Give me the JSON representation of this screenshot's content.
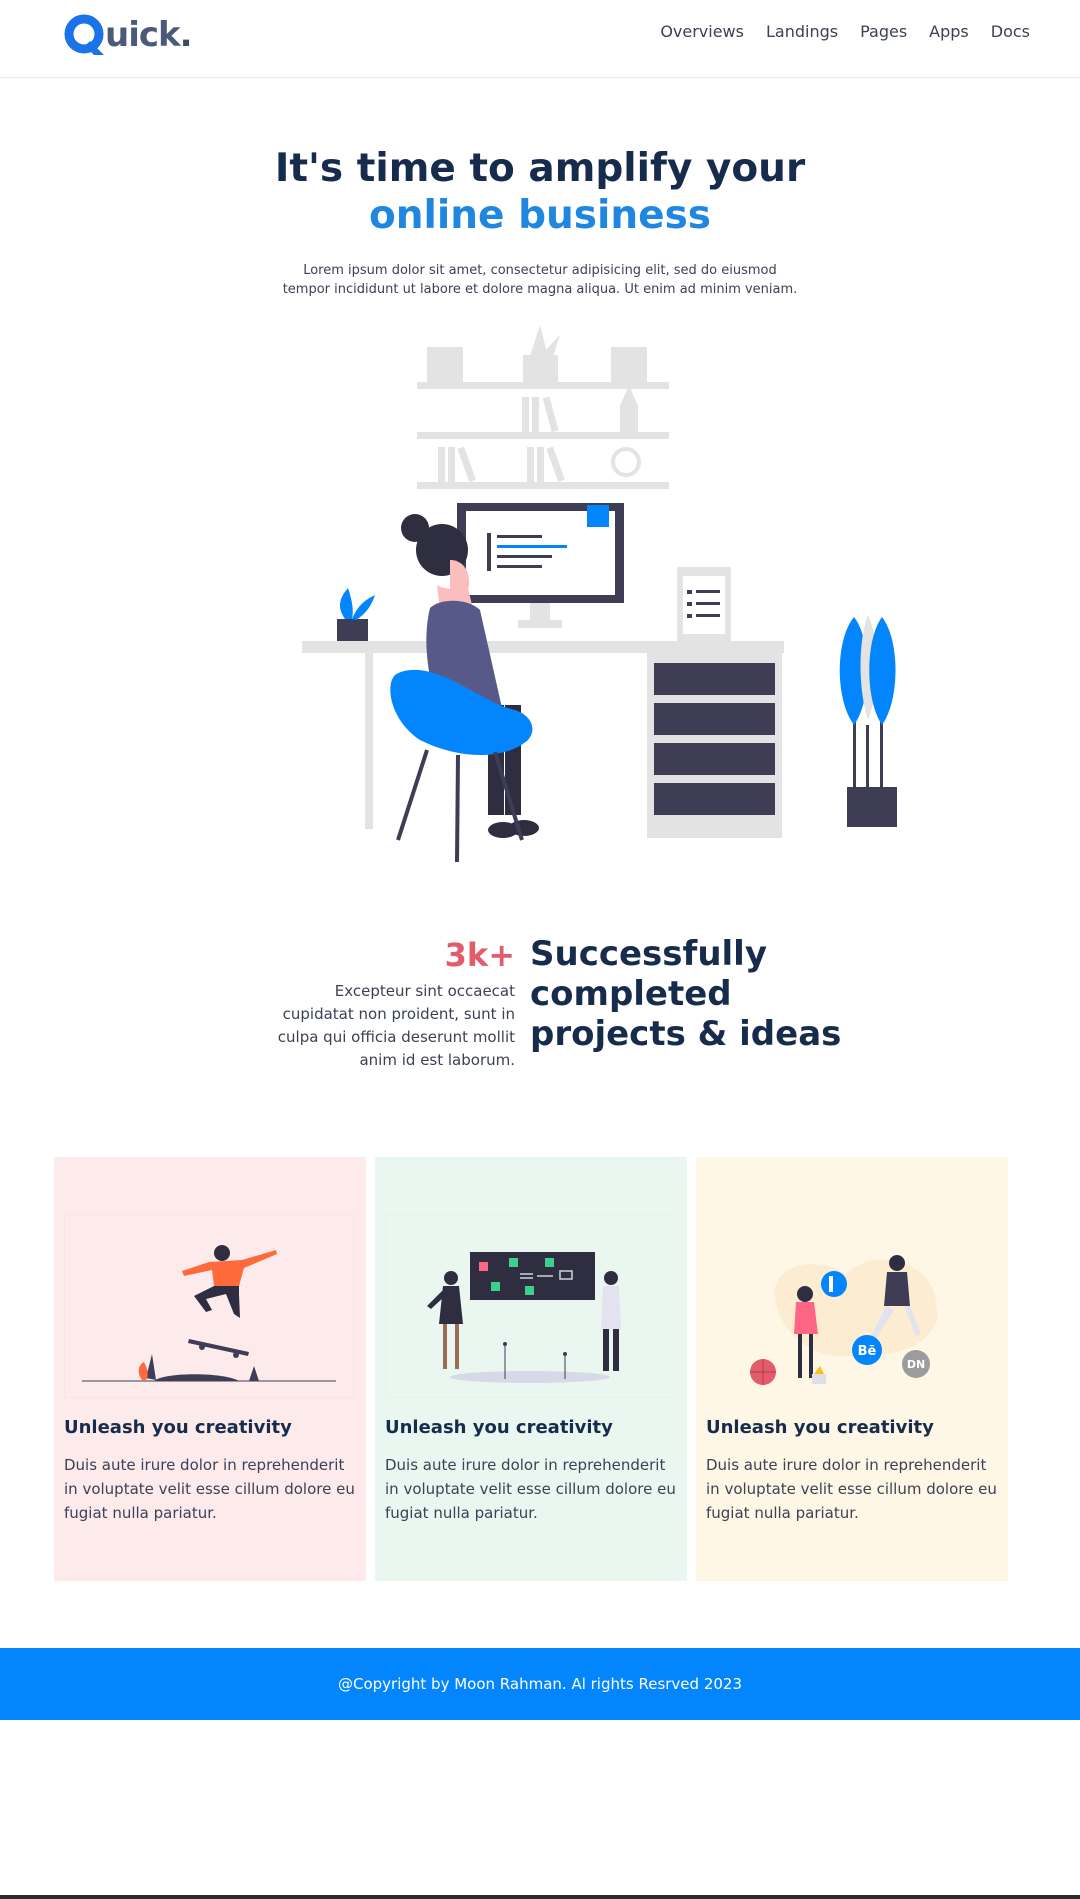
{
  "brand": {
    "logo_letter": "Q",
    "logo_text": "uick",
    "logo_dot": ".",
    "accent_color": "#1f87e0"
  },
  "nav": {
    "items": [
      {
        "label": "Overviews"
      },
      {
        "label": "Landings"
      },
      {
        "label": "Pages"
      },
      {
        "label": "Apps"
      },
      {
        "label": "Docs"
      }
    ]
  },
  "hero": {
    "title_line1": "It's time to amplify your",
    "title_line2": "online business",
    "subtitle": "Lorem ipsum dolor sit amet, consectetur adipisicing elit, sed do eiusmod tempor incididunt ut labore et dolore magna aliqua. Ut enim ad minim veniam.",
    "illustration": "person-working-at-desk-illustration"
  },
  "stats": {
    "number": "3k+",
    "description": "Excepteur sint occaecat cupidatat non proident, sunt in culpa qui officia deserunt mollit anim id est laborum.",
    "headline": "Successfully completed projects & ideas",
    "number_color": "#e25c6b"
  },
  "cards": [
    {
      "title": "Unleash you creativity",
      "text": "Duis aute irure dolor in reprehenderit in voluptate velit esse cillum dolore eu fugiat nulla pariatur.",
      "background": "#fdebec",
      "illustration": "skateboarder-illustration"
    },
    {
      "title": "Unleash you creativity",
      "text": "Duis aute irure dolor in reprehenderit in voluptate velit esse cillum dolore eu fugiat nulla pariatur.",
      "background": "#eaf7f1",
      "illustration": "presentation-board-illustration"
    },
    {
      "title": "Unleash you creativity",
      "text": "Duis aute irure dolor in reprehenderit in voluptate velit esse cillum dolore eu fugiat nulla pariatur.",
      "background": "#fff7e6",
      "illustration": "social-network-people-illustration",
      "icon_labels": [
        "Bē",
        "DN"
      ]
    }
  ],
  "footer": {
    "copyright": "@Copyright by Moon Rahman. Al rights Resrved 2023",
    "background": "#0386fd"
  }
}
